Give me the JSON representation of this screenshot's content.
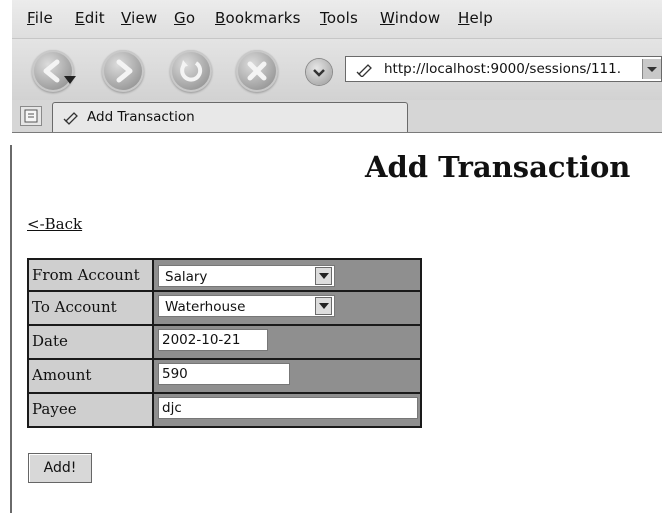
{
  "browser": {
    "menu": [
      "File",
      "Edit",
      "View",
      "Go",
      "Bookmarks",
      "Tools",
      "Window",
      "Help"
    ],
    "url": "http://localhost:9000/sessions/111.",
    "tab_title": "Add Transaction"
  },
  "page": {
    "title": "Add Transaction",
    "back_link": "<-Back",
    "form": {
      "from_account_label": "From Account",
      "from_account_value": "Salary",
      "to_account_label": "To Account",
      "to_account_value": "Waterhouse",
      "date_label": "Date",
      "date_value": "2002-10-21",
      "amount_label": "Amount",
      "amount_value": "590",
      "payee_label": "Payee",
      "payee_value": "djc",
      "submit_label": "Add!"
    }
  }
}
